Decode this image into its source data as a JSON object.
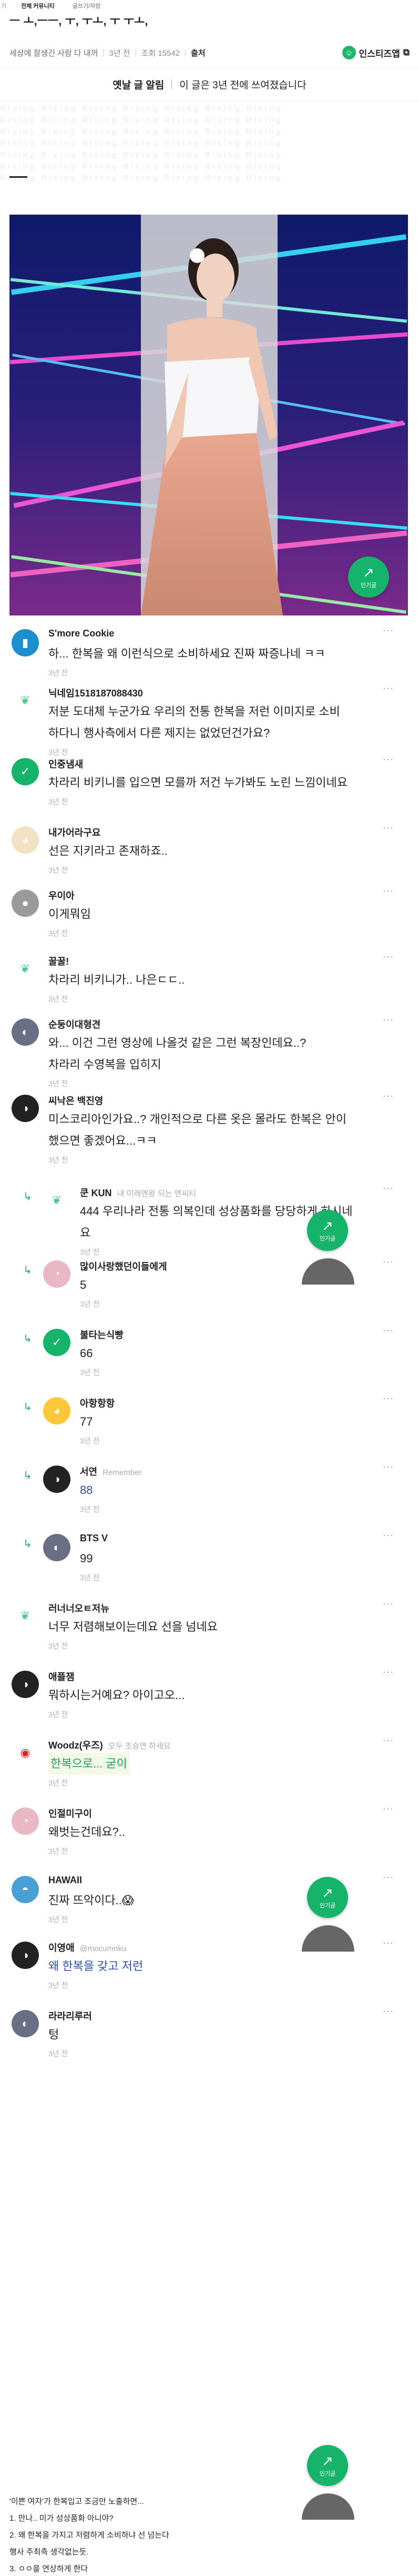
{
  "topbar": {
    "back_symbol": "기",
    "crumb_community": "전체 커뮤니티",
    "crumb_board": "글쓰기/자랑"
  },
  "post": {
    "title": "ㅡ ㅗ,ㅡㅡ, ㅜ, ㅜㅗ, ㅜ ㅜㅗ,",
    "author": "세상에 잘생긴 사람 다 내꺼",
    "age": "3년 전",
    "views": "조회 15542",
    "source_label": "출처",
    "instagram_label": "인스티즈앱",
    "notice_title": "옛날 글 알림",
    "notice_text": "이 글은 3년 전에 쓰여졌습니다"
  },
  "watermark": "Rising Rising Rising Rising Rising Rising Rising",
  "fab": {
    "label": "인기글",
    "icon": "trending-up-icon"
  },
  "comments": [
    {
      "nick": "S'more Cookie",
      "body": [
        "하... 한복을 왜 이런식으로 소비하세요 진짜 짜증나네 ㅋㅋ"
      ],
      "time": "3년 전",
      "avatar": "mouthwash-avatar",
      "reply": false
    },
    {
      "nick": "닉네임1518187088430",
      "body": [
        "저분 도대체 누군가요 우리의 전통 한복을 저런 이미지로 소비",
        "하다니 행사측에서 다른 제지는 없었던건가요?"
      ],
      "time": "3년 전",
      "avatar": "leaf-avatar",
      "reply": false
    },
    {
      "nick": "인중냄새",
      "body": [
        "차라리 비키니를 입으면 모를까 저건 누가봐도 노린 느낌이네요"
      ],
      "time": "3년 전",
      "avatar": "green-check-avatar",
      "reply": false
    },
    {
      "nick": "내가어라구요",
      "body": [
        "선은 지키라고 존재하죠.."
      ],
      "time": "3년 전",
      "avatar": "dog-avatar",
      "reply": false
    },
    {
      "nick": "우이아",
      "body": [
        "이게뭐임"
      ],
      "time": "3년 전",
      "avatar": "grey-avatar",
      "reply": false
    },
    {
      "nick": "꿀꿀!",
      "body": [
        "차라리 비키니가.. 나은ㄷㄷ.."
      ],
      "time": "3년 전",
      "avatar": "leaf-avatar",
      "reply": false
    },
    {
      "nick": "순둥이대형견",
      "body": [
        "와... 이건 그런 영상에 나올것 같은 그런 복장인데요..?",
        "차라리 수영복을 입히지"
      ],
      "time": "3년 전",
      "avatar": "photo-avatar",
      "reply": false
    },
    {
      "nick": "씨낙은 백진영",
      "body": [
        "미스코리아인가요..? 개인적으로 다른 옷은 몰라도 한복은 안이",
        "했으면 좋겠어요...ㅋㅋ"
      ],
      "time": "3년 전",
      "avatar": "dark-avatar",
      "reply": false
    },
    {
      "nick": "쿤 KUN",
      "sub": "내 미래엔왕 되는 엔씨티",
      "body": [
        "444 우리나라 전통 의복인데 성상품화를 당당하게 하시네",
        "요"
      ],
      "time": "3년 전",
      "avatar": "leaf-avatar",
      "reply": true
    },
    {
      "nick": "많이사랑했던이들에게",
      "body": [
        "5"
      ],
      "time": "3년 전",
      "avatar": "pink-avatar",
      "reply": true
    },
    {
      "nick": "불타는식빵",
      "body": [
        "66"
      ],
      "time": "3년 전",
      "avatar": "green-check-avatar",
      "reply": true
    },
    {
      "nick": "아항항항",
      "body": [
        "77"
      ],
      "time": "3년 전",
      "avatar": "duck-avatar",
      "reply": true
    },
    {
      "nick": "서연",
      "sub": "Remember",
      "body": [
        "88"
      ],
      "time": "3년 전",
      "avatar": "dark-avatar",
      "reply": true,
      "blue": true
    },
    {
      "nick": "BTS V",
      "body": [
        "99"
      ],
      "time": "3년 전",
      "avatar": "photo-avatar",
      "reply": true
    },
    {
      "nick": "러너너오ㅌ저뉴",
      "body": [
        "너무 저렴해보이는데요 선을 넘네요"
      ],
      "time": "3년 전",
      "avatar": "leaf-avatar",
      "reply": false
    },
    {
      "nick": "애플잼",
      "body": [
        "뭐하시는거예요? 아이고오..."
      ],
      "time": "3년 전",
      "avatar": "dark-avatar",
      "reply": false
    },
    {
      "nick": "Woodz(우즈)",
      "sub": "모두 조승연 하세요",
      "body": [
        "한복으로... 굳이"
      ],
      "time": "3년 전",
      "avatar": "mario-avatar",
      "reply": false,
      "green": true
    },
    {
      "nick": "인절미구이",
      "body": [
        "왜벗는건데요?.."
      ],
      "time": "3년 전",
      "avatar": "pink-avatar",
      "reply": false
    },
    {
      "nick": "HAWAII",
      "body": [
        "진짜 뜨악이다..😱"
      ],
      "time": "3년 전",
      "avatar": "sea-avatar",
      "reply": false
    },
    {
      "nick": "이영애",
      "sub": "@mocumnku",
      "body": [
        "왜 한복을 갖고 저런"
      ],
      "time": "3년 전",
      "avatar": "dark-avatar",
      "reply": false,
      "blue": true
    },
    {
      "nick": "라라리루러",
      "body": [
        "텅"
      ],
      "time": "3년 전",
      "avatar": "photo-avatar",
      "reply": false
    }
  ],
  "footer": [
    "'이쁜 여자'가 한복입고 조금만 노출하면...",
    "1. 만나.. 미가 성상품화 아니야?",
    "2. 왜 한복을 가지고 저렴하게 소비하냐 선 넘는다",
    "행사 주최측 생각없는듯.",
    "3. ㅇㅇ을 연상하게 한다"
  ]
}
